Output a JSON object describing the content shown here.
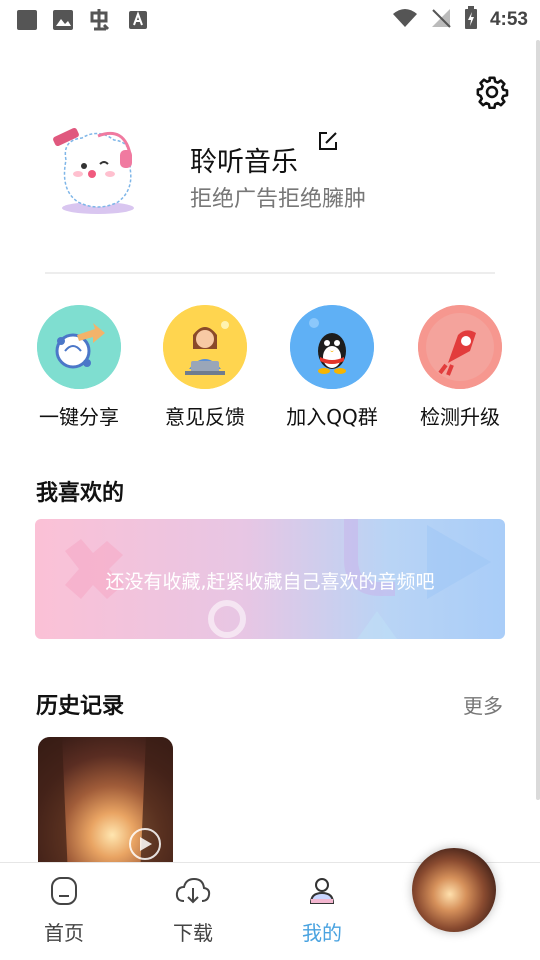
{
  "status_bar": {
    "time": "4:53",
    "left_icons": [
      "square-icon",
      "image-icon",
      "app-icon",
      "text-icon"
    ],
    "right_icons": [
      "wifi-icon",
      "no-signal-icon",
      "battery-charging-icon"
    ]
  },
  "profile": {
    "name": "聆听音乐",
    "subtitle": "拒绝广告拒绝臃肿"
  },
  "actions": [
    {
      "label": "一键分享",
      "icon": "share-icon"
    },
    {
      "label": "意见反馈",
      "icon": "feedback-icon"
    },
    {
      "label": "加入QQ群",
      "icon": "qq-penguin-icon"
    },
    {
      "label": "检测升级",
      "icon": "upgrade-icon"
    }
  ],
  "favorites": {
    "title": "我喜欢的",
    "empty_text": "还没有收藏,赶紧收藏自己喜欢的音频吧"
  },
  "history": {
    "title": "历史记录",
    "more_label": "更多"
  },
  "bottom_nav": [
    {
      "label": "首页",
      "icon": "home-icon",
      "active": false
    },
    {
      "label": "下载",
      "icon": "cloud-download-icon",
      "active": false
    },
    {
      "label": "我的",
      "icon": "profile-icon",
      "active": true
    }
  ],
  "colors": {
    "accent": "#4aa3e0",
    "share_bg": "#7fded0",
    "feedback_bg": "#ffd54f",
    "qq_bg": "#5fb0f5",
    "upgrade_bg": "#f6978f"
  }
}
